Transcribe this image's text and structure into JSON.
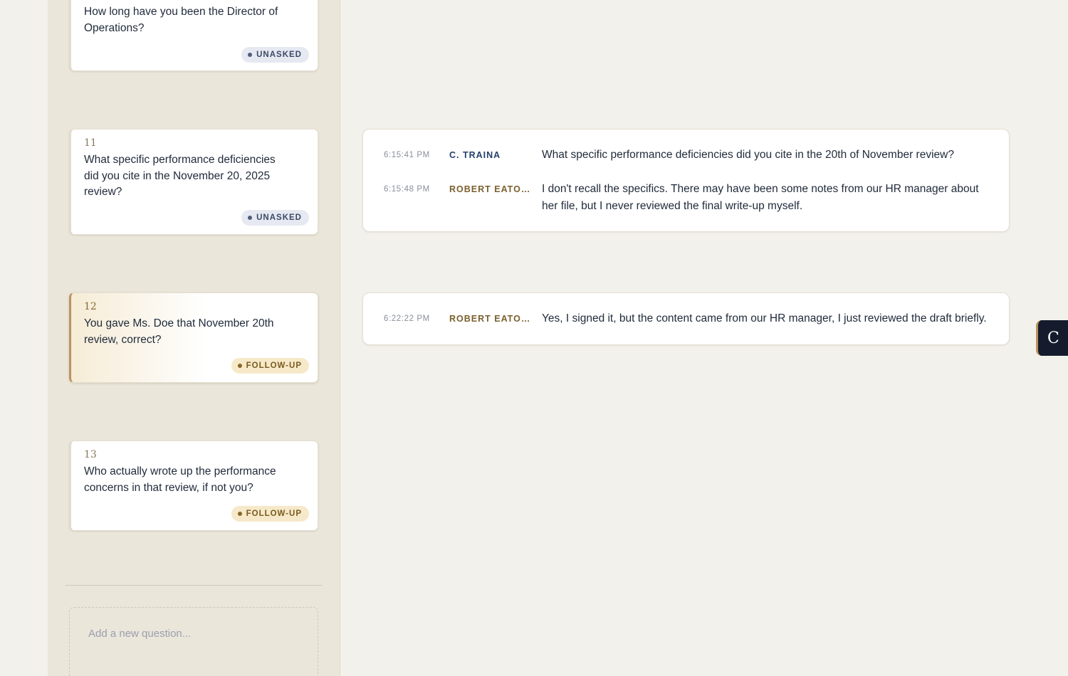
{
  "questions": [
    {
      "number": "",
      "text": "How long have you been the Director of Operations?",
      "status": "UNASKED",
      "status_type": "unasked"
    },
    {
      "number": "11",
      "text": "What specific performance deficiencies did you cite in the November 20, 2025 review?",
      "status": "UNASKED",
      "status_type": "unasked"
    },
    {
      "number": "12",
      "text": "You gave Ms. Doe that November 20th review, correct?",
      "status": "FOLLOW-UP",
      "status_type": "followup",
      "active": true
    },
    {
      "number": "13",
      "text": "Who actually wrote up the performance concerns in that review, if not you?",
      "status": "FOLLOW-UP",
      "status_type": "followup"
    }
  ],
  "new_question": {
    "placeholder": "Add a new question..."
  },
  "transcript": [
    {
      "rows": [
        {
          "time": "6:15:41 PM",
          "speaker": "C. TRAINA",
          "role": "attorney",
          "text": "What specific performance deficiencies did you cite in the 20th of November review?"
        },
        {
          "time": "6:15:48 PM",
          "speaker": "ROBERT EATON, …",
          "role": "witness",
          "text": "I don't recall the specifics. There may have been some notes from our HR manager about her file, but I never reviewed the final write-up myself."
        }
      ]
    },
    {
      "rows": [
        {
          "time": "6:22:22 PM",
          "speaker": "ROBERT EATON, …",
          "role": "witness",
          "text": "Yes, I signed it, but the content came from our HR manager, I just reviewed the draft briefly."
        }
      ]
    }
  ],
  "side_tab": {
    "label": "C"
  },
  "colors": {
    "background": "#f3f1ec",
    "sidebar": "#ebe6da",
    "accent_gold": "#b89660",
    "attorney": "#24406a",
    "witness": "#7b5f2c",
    "dark_tab": "#151b2c"
  }
}
